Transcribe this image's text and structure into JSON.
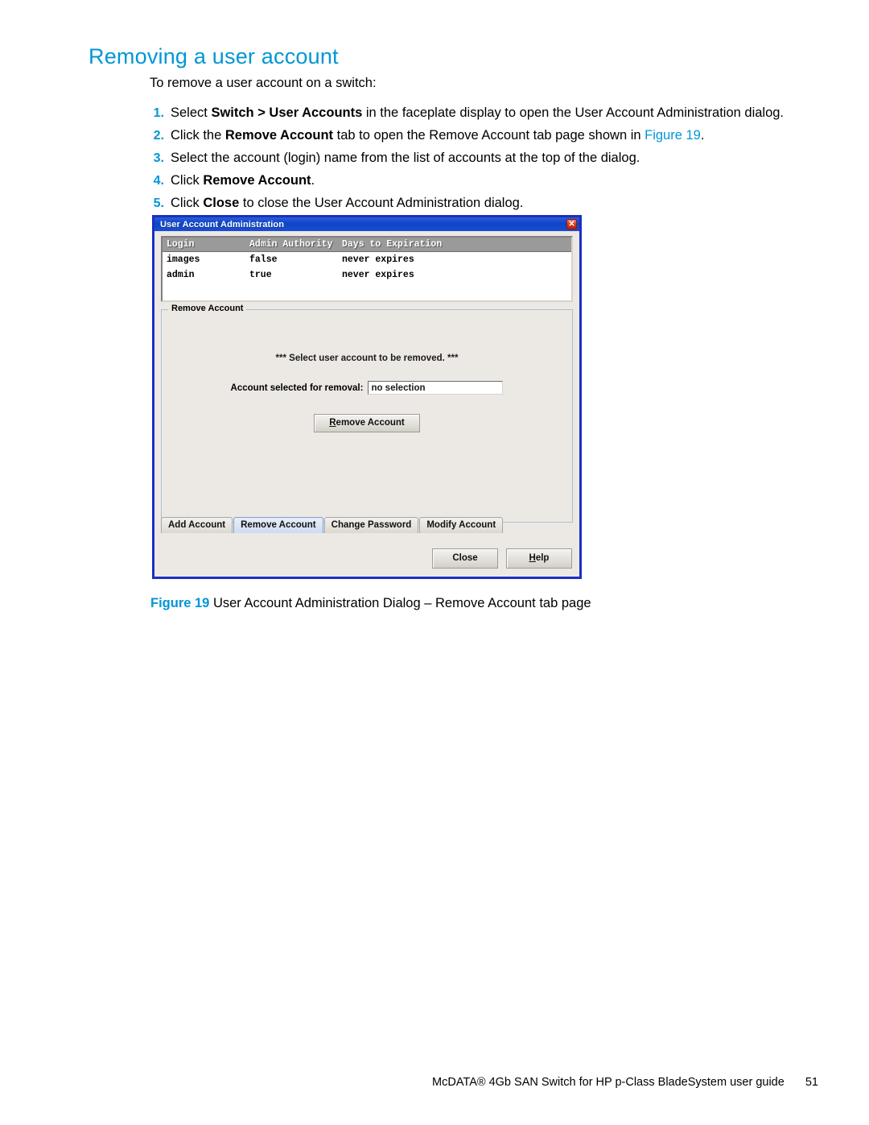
{
  "page": {
    "title": "Removing a user account",
    "intro": "To remove a user account on a switch:",
    "steps": [
      {
        "num": "1.",
        "html": "Select <b>Switch &gt; User Accounts</b> in the faceplate display to open the User Account Administration dialog."
      },
      {
        "num": "2.",
        "html": "Click the <b>Remove Account</b> tab to open the Remove Account tab page shown in <span class=\"lnk\">Figure 19</span>."
      },
      {
        "num": "3.",
        "html": "Select the account (login) name from the list of accounts at the top of the dialog."
      },
      {
        "num": "4.",
        "html": "Click <b>Remove Account</b>."
      },
      {
        "num": "5.",
        "html": "Click <b>Close</b> to close the User Account Administration dialog."
      }
    ],
    "figure_caption_label": "Figure 19",
    "figure_caption_text": "User Account Administration Dialog – Remove Account tab page",
    "footer_text": "McDATA® 4Gb SAN Switch for HP p-Class BladeSystem user guide",
    "footer_page": "51",
    "accent_color": "#0096d6"
  },
  "dialog": {
    "title": "User Account Administration",
    "close_glyph": "✕",
    "titlebar_color": "#0e43c8",
    "frame_color": "#1b2fc4",
    "accounts_table": {
      "columns": [
        "Login",
        "Admin Authority",
        "Days to Expiration"
      ],
      "rows": [
        {
          "login": "images",
          "admin_authority": "false",
          "days_to_expiration": "never expires"
        },
        {
          "login": "admin",
          "admin_authority": "true",
          "days_to_expiration": "never expires"
        }
      ]
    },
    "panel": {
      "legend": "Remove Account",
      "message": "*** Select user account to be removed. ***",
      "field_label": "Account selected for removal:",
      "field_value": "no selection",
      "field_placeholder": "no selection",
      "action_button": {
        "mnemonic": "R",
        "rest": "emove Account"
      }
    },
    "tabs": [
      {
        "label": "Add Account",
        "active": false
      },
      {
        "label": "Remove Account",
        "active": true
      },
      {
        "label": "Change Password",
        "active": false
      },
      {
        "label": "Modify Account",
        "active": false
      }
    ],
    "actions": [
      {
        "label": "Close",
        "mnemonic": "",
        "rest": "Close"
      },
      {
        "label": "Help",
        "mnemonic": "H",
        "rest": "elp"
      }
    ]
  }
}
